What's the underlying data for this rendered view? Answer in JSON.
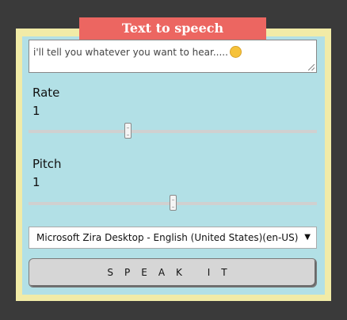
{
  "app": {
    "title": "Text to speech"
  },
  "text_input": {
    "value": "i'll tell you whatever you want to hear.....",
    "emoji": "winking-face"
  },
  "rate": {
    "label": "Rate",
    "value": "1",
    "slider_fraction": 0.34
  },
  "pitch": {
    "label": "Pitch",
    "value": "1",
    "slider_fraction": 0.5
  },
  "voice_select": {
    "selected": "Microsoft Zira Desktop - English (United States)(en-US)"
  },
  "speak_button": {
    "label": "SPEAK IT"
  },
  "colors": {
    "background": "#3a3a3a",
    "frame": "#f1eba7",
    "panel": "#b2e0e6",
    "title_tab": "#ec6661",
    "button": "#d6d6d6"
  }
}
